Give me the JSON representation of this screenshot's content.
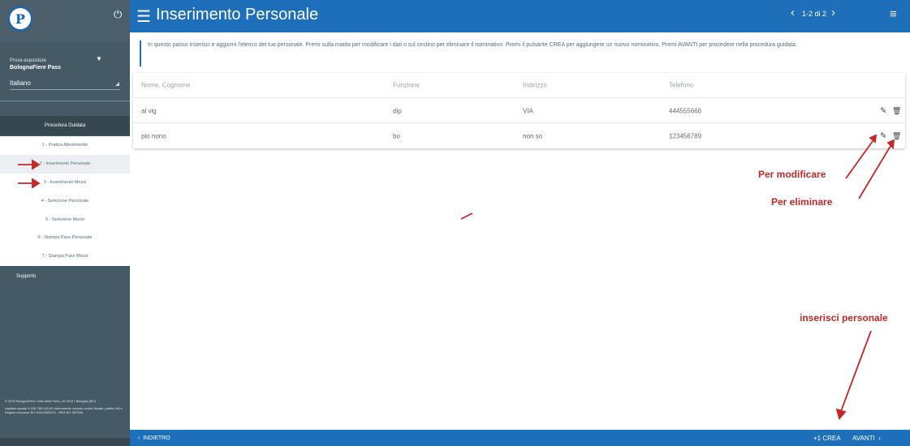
{
  "sidebar": {
    "logo_letter": "P",
    "power_icon": "power-icon",
    "expositor_label": "Prova espositore",
    "expositor_name": "BolognaFiere Pass",
    "language": "Italiano",
    "procedure_header": "Procedura Guidata",
    "steps": [
      "1 - Pratica Allestimento",
      "2 - Inserimento Personale",
      "3 - Inserimento Mezzi",
      "4 - Selezione Personale",
      "5 - Selezione Mezzi",
      "6 - Stampa Pass Personale",
      "7 - Stampa Pass Mezzi"
    ],
    "support": "Supporto",
    "footer": [
      "© 2020 BolognaFiere Viale della Fiera, 20 40127 Bologna (BO)",
      "capitale sociale € 106.780.000,00 interamente versato codice fiscale, partita IVA e Registro Imprese BO 00312600372 - REA BO 367296"
    ]
  },
  "header": {
    "title": "Inserimento Personale",
    "pager": "1-2 di 2",
    "color": "#1e6fb9"
  },
  "info": {
    "text": "In questo passo inserisci e aggiorni l'elenco del tuo personale. Premi sulla matita per modificare i dati o sul cestino per eliminare il nominativo. Premi il pulsante CREA per aggiungere un nuovo nominativo. Premi AVANTI per procedere nella procedura guidata."
  },
  "table": {
    "columns": [
      "Nome, Cognome",
      "Funzione",
      "Indirizzo",
      "Telefono"
    ],
    "rows": [
      [
        "al vig",
        "dip",
        "VIA",
        "444555666"
      ],
      [
        "pio nono",
        "bo",
        "non so",
        "123456789"
      ]
    ]
  },
  "annotations": {
    "modify": "Per modificare",
    "delete": "Per eliminare",
    "insert": "inserisci personale",
    "color": "#c62828"
  },
  "bottom": {
    "back": "INDIETRO",
    "create": "+1  CREA",
    "next": "AVANTI"
  }
}
